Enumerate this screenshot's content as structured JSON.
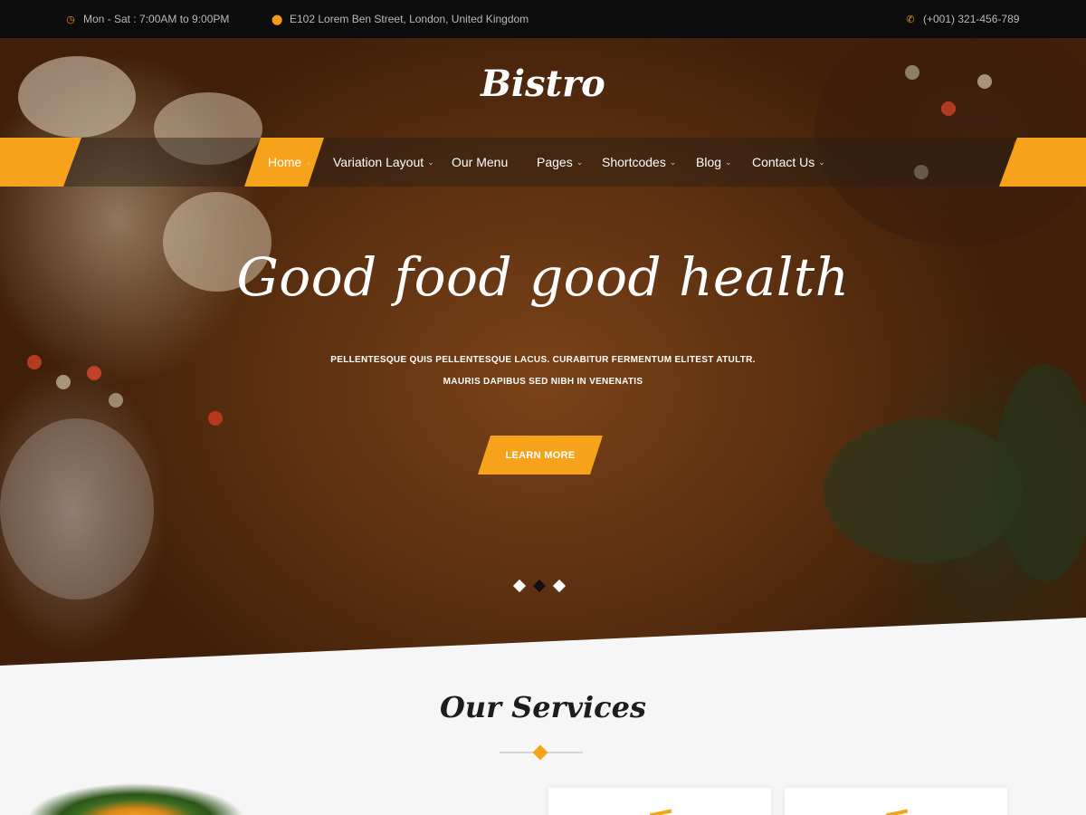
{
  "topbar": {
    "hours": "Mon - Sat : 7:00AM to 9:00PM",
    "address": "E102 Lorem Ben Street, London, United Kingdom",
    "phone": "(+001) 321-456-789",
    "icon_hours": "clock-icon",
    "icon_address": "map-marker-icon",
    "icon_phone": "phone-icon"
  },
  "brand": {
    "logo": "Bistro"
  },
  "nav": {
    "items": [
      {
        "label": "Home",
        "active": true,
        "has_dropdown": true
      },
      {
        "label": "Variation Layout",
        "has_dropdown": true
      },
      {
        "label": "Our Menu",
        "has_dropdown": false
      },
      {
        "label": "Pages",
        "has_dropdown": true
      },
      {
        "label": "Shortcodes",
        "has_dropdown": true
      },
      {
        "label": "Blog",
        "has_dropdown": true
      },
      {
        "label": "Contact Us",
        "has_dropdown": true
      }
    ],
    "chevron": "⌄"
  },
  "hero": {
    "headline": "Good food good health",
    "subline1": "PELLENTESQUE QUIS PELLENTESQUE LACUS. CURABITUR FERMENTUM ELITEST ATULTR.",
    "subline2": "MAURIS DAPIBUS SED NIBH IN VENENATIS",
    "cta": "LEARN MORE",
    "slides": 3,
    "active_slide": 2
  },
  "services": {
    "title": "Our Services"
  },
  "colors": {
    "accent": "#f7a21b",
    "topbar": "#0c0c0c",
    "text_dark": "#1d1d1d"
  }
}
